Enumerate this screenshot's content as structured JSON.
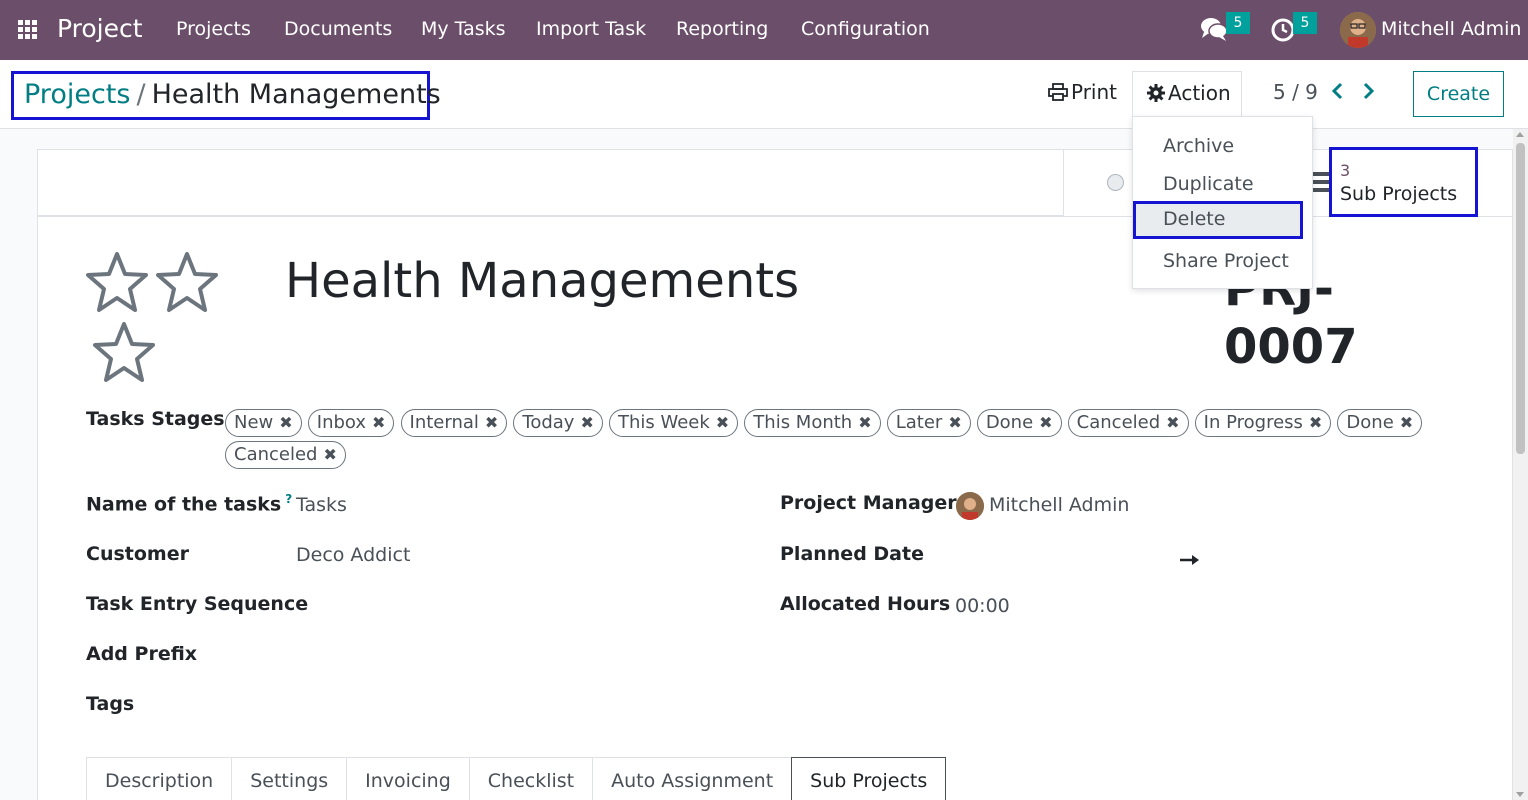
{
  "navbar": {
    "brand": "Project",
    "menu": [
      "Projects",
      "Documents",
      "My Tasks",
      "Import Task",
      "Reporting",
      "Configuration"
    ],
    "messages_count": "5",
    "activities_count": "5",
    "user_name": "Mitchell Admin",
    "bg_color": "#6b4e69",
    "badge_color": "#00a09d"
  },
  "breadcrumb": {
    "parent": "Projects",
    "separator": "/",
    "current": "Health Managements"
  },
  "control": {
    "print_label": "Print",
    "action_label": "Action",
    "pager": "5 / 9",
    "create_label": "Create"
  },
  "action_menu": {
    "items": [
      "Archive",
      "Duplicate",
      "Delete",
      "Share Project"
    ],
    "highlighted": "Delete"
  },
  "smart_button": {
    "count": "3",
    "label": "Sub Projects"
  },
  "form": {
    "title": "Health Managements",
    "sequence_line1": "PRJ-",
    "sequence_line2": "0007",
    "stages_label": "Tasks Stages",
    "stages": [
      "New",
      "Inbox",
      "Internal",
      "Today",
      "This Week",
      "This Month",
      "Later",
      "Done",
      "Canceled",
      "In Progress",
      "Done",
      "Canceled"
    ],
    "left_fields": [
      {
        "label": "Name of the tasks",
        "value": "Tasks",
        "help": "?"
      },
      {
        "label": "Customer",
        "value": "Deco Addict"
      },
      {
        "label": "Task Entry Sequence",
        "value": ""
      },
      {
        "label": "Add Prefix",
        "value": ""
      },
      {
        "label": "Tags",
        "value": ""
      }
    ],
    "right_fields": [
      {
        "label": "Project Manager",
        "value": "Mitchell Admin"
      },
      {
        "label": "Planned Date",
        "value": ""
      },
      {
        "label": "Allocated Hours",
        "value": "00:00"
      }
    ],
    "tabs": [
      "Description",
      "Settings",
      "Invoicing",
      "Checklist",
      "Auto Assignment",
      "Sub Projects"
    ],
    "active_tab": "Sub Projects"
  },
  "icons": [
    "apps-grid-icon",
    "chat-icon",
    "clock-icon",
    "printer-icon",
    "gear-icon",
    "chevron-left-icon",
    "chevron-right-icon",
    "star-icon",
    "hamburger-icon",
    "arrow-right-icon",
    "remove-tag-icon"
  ],
  "colors": {
    "link": "#017e84",
    "highlight_border": "#1414d2"
  }
}
